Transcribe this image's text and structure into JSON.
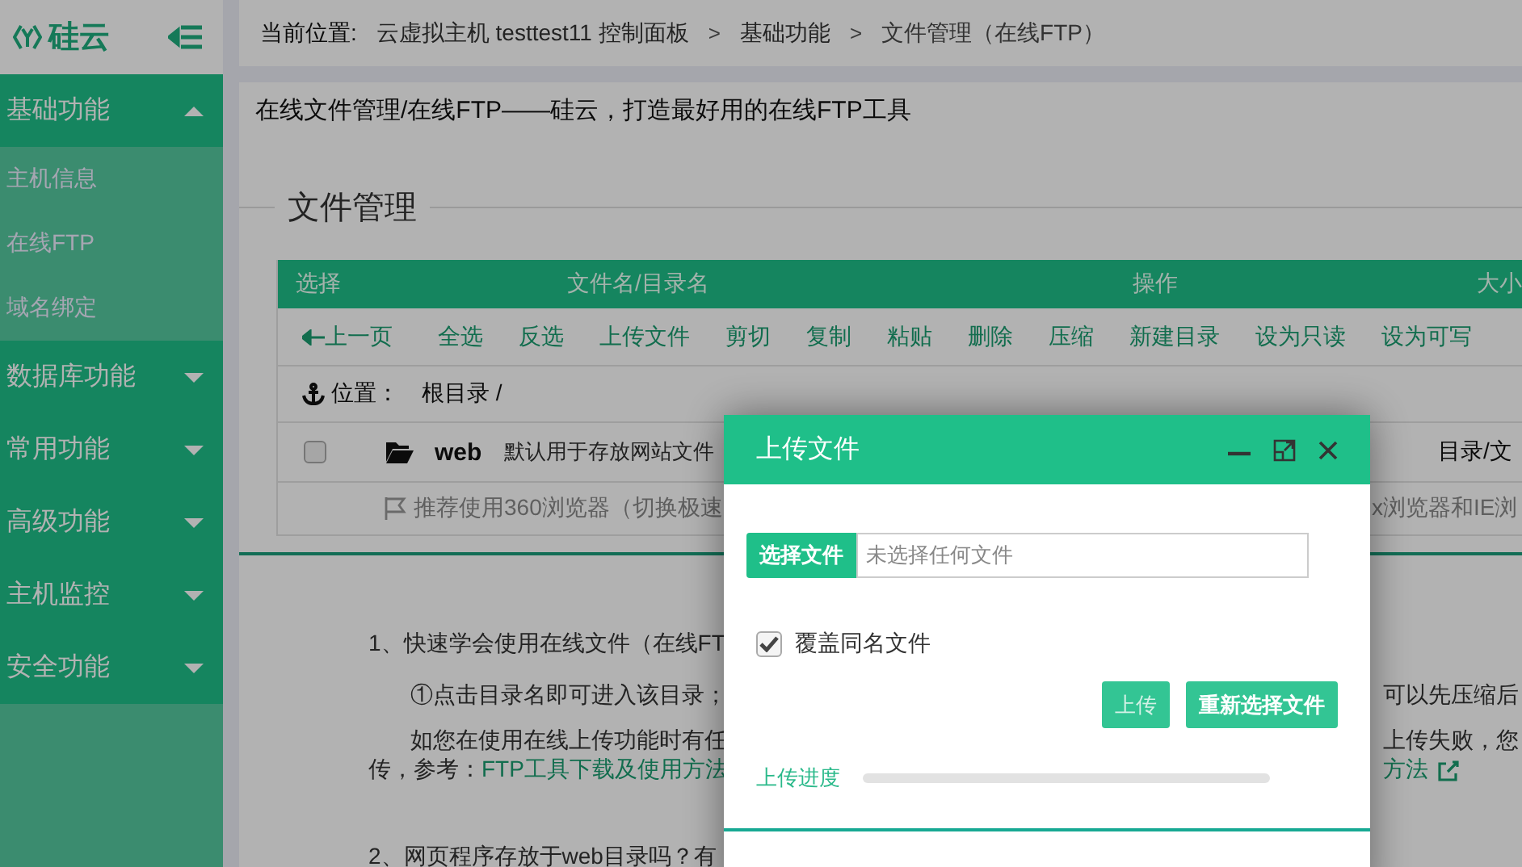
{
  "sidebar": {
    "logo": "硅云",
    "sections": [
      {
        "label": "基础功能",
        "expanded": true,
        "items": [
          {
            "label": "主机信息"
          },
          {
            "label": "在线FTP"
          },
          {
            "label": "域名绑定"
          }
        ]
      },
      {
        "label": "数据库功能",
        "expanded": false
      },
      {
        "label": "常用功能",
        "expanded": false
      },
      {
        "label": "高级功能",
        "expanded": false
      },
      {
        "label": "主机监控",
        "expanded": false
      },
      {
        "label": "安全功能",
        "expanded": false
      }
    ]
  },
  "breadcrumb": {
    "prefix": "当前位置:",
    "items": [
      {
        "kind": "link",
        "label": "云虚拟主机 testtest11 控制面板"
      },
      {
        "kind": "separator",
        "label": ">"
      },
      {
        "kind": "link",
        "label": "基础功能"
      },
      {
        "kind": "separator",
        "label": ">"
      },
      {
        "kind": "current",
        "label": "文件管理（在线FTP）"
      }
    ]
  },
  "intro": "在线文件管理/在线FTP——硅云，打造最好用的在线FTP工具",
  "file_manager": {
    "legend": "文件管理",
    "columns": [
      "选择",
      "文件名/目录名",
      "操作",
      "大小"
    ],
    "toolbar": [
      {
        "kind": "back",
        "label": "上一页"
      },
      {
        "kind": "action",
        "label": "全选"
      },
      {
        "kind": "action",
        "label": "反选"
      },
      {
        "kind": "action",
        "label": "上传文件"
      },
      {
        "kind": "action",
        "label": "剪切"
      },
      {
        "kind": "action",
        "label": "复制"
      },
      {
        "kind": "action",
        "label": "粘贴"
      },
      {
        "kind": "action",
        "label": "删除"
      },
      {
        "kind": "action",
        "label": "压缩"
      },
      {
        "kind": "action",
        "label": "新建目录"
      },
      {
        "kind": "action",
        "label": "设为只读"
      },
      {
        "kind": "action",
        "label": "设为可写"
      }
    ],
    "location": {
      "label": "位置：",
      "path": "根目录 /"
    },
    "rows": [
      {
        "checked": false,
        "name": "web",
        "description": "默认用于存放网站文件",
        "type": "目录/文"
      }
    ],
    "notice": {
      "left": "推荐使用360浏览器（切换极速",
      "right": "x浏览器和IE浏"
    }
  },
  "help": [
    {
      "kind": "heading",
      "text": "1、快速学会使用在线文件（在线FT"
    },
    {
      "kind": "para",
      "left": "①点击目录名即可进入该目录；",
      "right": "可以先压缩后"
    },
    {
      "kind": "para",
      "left": "如您在使用在线上传功能时有任",
      "right": "上传失败，您"
    },
    {
      "kind": "links",
      "prefix": "传，参考：",
      "link": "FTP工具下载及使用方法",
      "right_link": "方法"
    },
    {
      "kind": "heading",
      "text": "2、网页程序存放于web目录吗？有"
    }
  ],
  "dialog": {
    "title": "上传文件",
    "choose_button": "选择文件",
    "file_status": "未选择任何文件",
    "overwrite": {
      "label": "覆盖同名文件",
      "checked": true
    },
    "buttons": [
      {
        "label": "上传",
        "disabled": true
      },
      {
        "label": "重新选择文件",
        "disabled": false
      }
    ],
    "progress": {
      "label": "上传进度",
      "level": 0
    }
  }
}
